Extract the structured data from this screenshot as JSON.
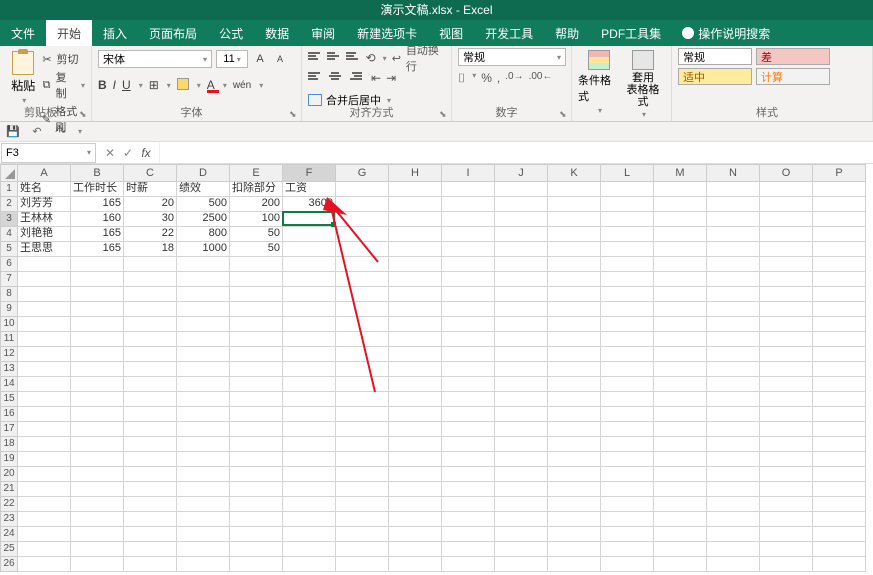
{
  "title": "演示文稿.xlsx  -  Excel",
  "tabs": [
    "文件",
    "开始",
    "插入",
    "页面布局",
    "公式",
    "数据",
    "审阅",
    "新建选项卡",
    "视图",
    "开发工具",
    "帮助",
    "PDF工具集"
  ],
  "tell_me": "操作说明搜索",
  "ribbon": {
    "clipboard": {
      "paste": "粘贴",
      "cut": "剪切",
      "copy": "复制",
      "painter": "格式刷",
      "group": "剪贴板"
    },
    "font": {
      "name": "宋体",
      "size": "11",
      "group": "字体"
    },
    "align": {
      "wrap": "自动换行",
      "merge": "合并后居中",
      "group": "对齐方式"
    },
    "number": {
      "format": "常规",
      "group": "数字"
    },
    "styles1": {
      "cond": "条件格式",
      "table": "套用\n表格格式"
    },
    "styles2": {
      "normal": "常规",
      "bad": "差",
      "neutral": "适中",
      "calc": "计算",
      "group": "样式"
    }
  },
  "namebox": "F3",
  "cols": [
    "A",
    "B",
    "C",
    "D",
    "E",
    "F",
    "G",
    "H",
    "I",
    "J",
    "K",
    "L",
    "M",
    "N",
    "O",
    "P"
  ],
  "headers": [
    "姓名",
    "工作时长",
    "时薪",
    "绩效",
    "扣除部分",
    "工资"
  ],
  "data_rows": [
    {
      "a": "刘芳芳",
      "b": "165",
      "c": "20",
      "d": "500",
      "e": "200",
      "f": "3600"
    },
    {
      "a": "王林林",
      "b": "160",
      "c": "30",
      "d": "2500",
      "e": "100",
      "f": ""
    },
    {
      "a": "刘艳艳",
      "b": "165",
      "c": "22",
      "d": "800",
      "e": "50",
      "f": ""
    },
    {
      "a": "王思思",
      "b": "165",
      "c": "18",
      "d": "1000",
      "e": "50",
      "f": ""
    }
  ],
  "selected_cell": "F3"
}
